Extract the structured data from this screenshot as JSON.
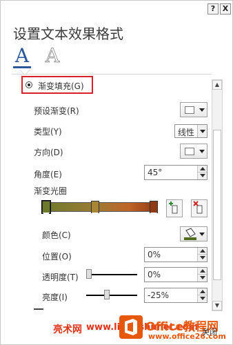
{
  "titlebar": {
    "help_label": "?",
    "close_label": "X"
  },
  "pane": {
    "title": "设置文本效果格式"
  },
  "tabs": [
    {
      "label": "A"
    },
    {
      "label": "A"
    }
  ],
  "fill": {
    "gradient_label": "渐变填充(G)",
    "preset_label": "预设渐变(R)",
    "type_label": "类型(Y)",
    "type_value": "线性",
    "direction_label": "方向(D)",
    "angle_label": "角度(E)",
    "angle_value": "45°",
    "stops_label": "渐变光圈",
    "color_label": "颜色(C)",
    "position_label": "位置(O)",
    "position_value": "0%",
    "transparency_label": "透明度(T)",
    "transparency_value": "0%",
    "transparency_level": 0,
    "brightness_label": "亮度(I)",
    "brightness_value": "-25%",
    "brightness_level": -0.25
  },
  "colors": {
    "accent": "#2b579a",
    "highlight_border": "#d9202a",
    "stop1": "#6d7a2a",
    "stop2": "#a88637",
    "stop3": "#8f3a12"
  },
  "watermark": {
    "site_cn": "亮术网",
    "site_url": "www.liangshunet.com",
    "brand": "Office教程网",
    "brand_url": "www.office26.com",
    "partial": "关闭"
  }
}
